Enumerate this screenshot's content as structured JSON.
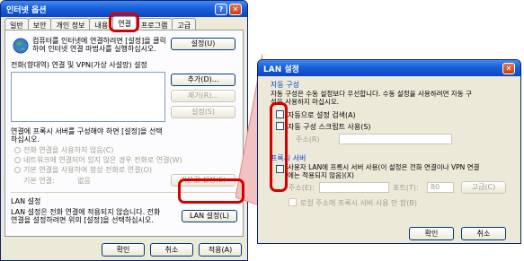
{
  "left_dialog": {
    "title": "인터넷 옵션",
    "tabs": [
      "일반",
      "보안",
      "개인 정보",
      "내용",
      "연결",
      "프로그램",
      "고급"
    ],
    "setup_text_1": "컴퓨터를 인터넷에 연결하려면 [설정]을 클릭",
    "setup_text_2": "하여 인터넷 연결 마법사를 실행하십시오.",
    "setup_button": "설정(U)",
    "dialup_title": "전화(향대역) 연결 및 VPN(가상 사설망) 설정",
    "add_button": "추가(D)...",
    "remove_button": "제거(R)...",
    "settings_button": "설정(S)",
    "proxy_text_1": "연결에 프록시 서버를 구성해야 하면 [설정]을 선택",
    "proxy_text_2": "하십시오.",
    "radio_1": "전화 연결을 사용하지 않음(C)",
    "radio_2": "네트워크에 연결되어 있지 않은 경우 전화로 연결(W)",
    "radio_3": "기본 연결을 사용하여 항상 전화로 연결(O)",
    "default_label": "기본 연결:",
    "default_value": "없음",
    "default_button": "기본값 설정(E)",
    "lan_title": "LAN 설정",
    "lan_text_1": "LAN 설정은 전화 연결에 적용되지 않습니다. 전화",
    "lan_text_2": "연결을 설정하려면 위의 [설정]을 선택하십시오.",
    "lan_button": "LAN 설정(L)",
    "ok": "확인",
    "cancel": "취소",
    "apply": "적용(A)"
  },
  "right_dialog": {
    "title": "LAN 설정",
    "auto_group": "자동 구성",
    "auto_text_1": "자동 구성은 수동 설정보다 우선합니다. 수동 설정을 사용하려면 자동 구",
    "auto_text_2": "성을 사용하지 마십시오.",
    "auto_detect": "자동으로 설정 검색(A)",
    "auto_script": "자동 구성 스크립트 사용(S)",
    "address_label": "주소(R)",
    "proxy_group": "프록시 서버",
    "proxy_check_1": "사용자 LAN에 프록시 서버 사용(이 설정은 전화 연결이나 VPN 연결",
    "proxy_check_2": "에는 적용되지 않음)(X)",
    "proxy_address": "주소(E):",
    "port_label": "포트(T):",
    "port_value": "80",
    "advanced_button": "고급(C)",
    "bypass_local": "로컬 주소에 프록시 서버 사용 안 함(B)",
    "ok": "확인",
    "cancel": "취소"
  },
  "colors": {
    "highlight": "#d40000",
    "title_bar": "#1a5fd8",
    "dialog_bg": "#ece9d8"
  }
}
